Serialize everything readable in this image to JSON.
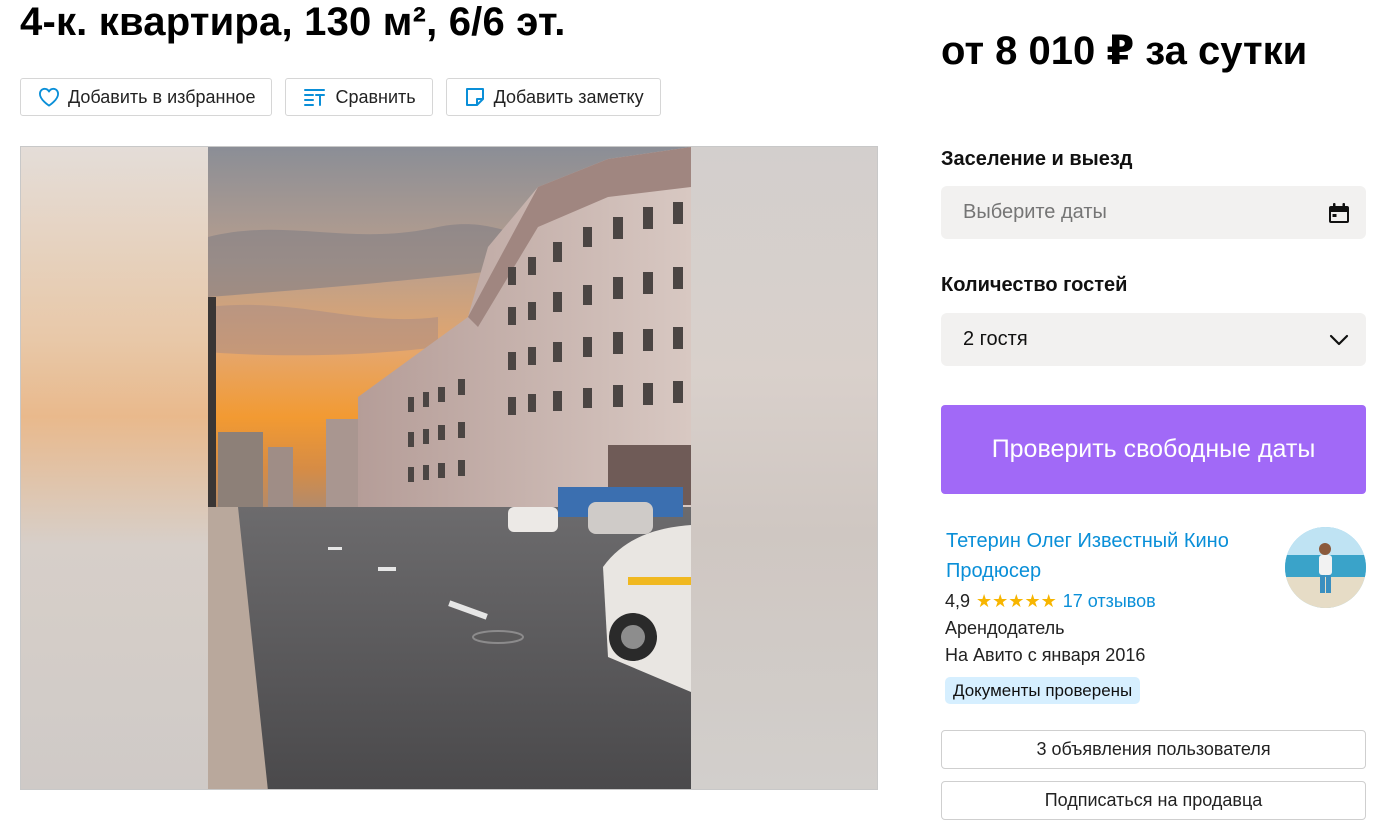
{
  "listing": {
    "title": "4-к. квартира, 130 м², 6/6 эт.",
    "actions": {
      "favorite": "Добавить в избранное",
      "compare": "Сравнить",
      "note": "Добавить заметку"
    }
  },
  "booking": {
    "price": "от 8 010 ₽ за сутки",
    "dates_label": "Заселение и выезд",
    "dates_placeholder": "Выберите даты",
    "guests_label": "Количество гостей",
    "guests_value": "2 гостя",
    "check_button": "Проверить свободные даты"
  },
  "seller": {
    "name": "Тетерин Олег Известный Кино Продюсер",
    "rating": "4,9",
    "stars": "★★★★★",
    "reviews": "17 отзывов",
    "role": "Арендодатель",
    "since": "На Авито с января 2016",
    "badge": "Документы проверены",
    "listings_button": "3 объявления пользователя",
    "subscribe_button": "Подписаться на продавца"
  },
  "colors": {
    "accent": "#a169f7",
    "link": "#0a8fd8",
    "star": "#f7b500",
    "badge_bg": "#d6efff"
  },
  "icons": [
    "heart-icon",
    "compare-icon",
    "note-icon",
    "calendar-icon",
    "chevron-down-icon"
  ]
}
